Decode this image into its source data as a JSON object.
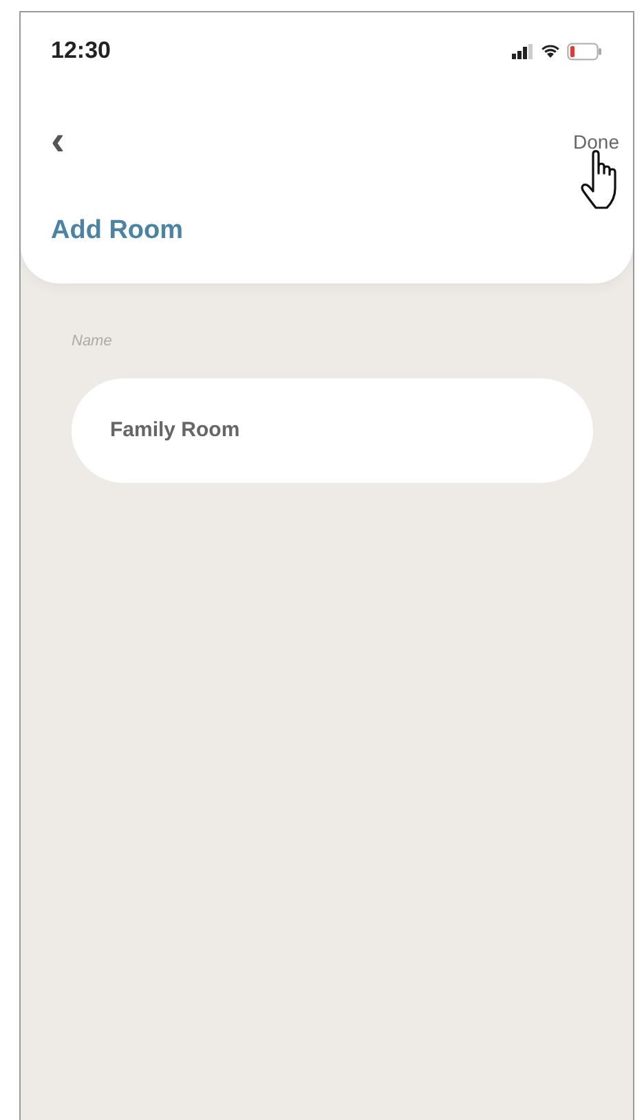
{
  "status_bar": {
    "time": "12:30",
    "battery_low": true
  },
  "nav": {
    "back": "‹",
    "done": "Done",
    "pointer": true
  },
  "title": "Add Room",
  "form": {
    "label": "Name",
    "value": "Family Room"
  }
}
